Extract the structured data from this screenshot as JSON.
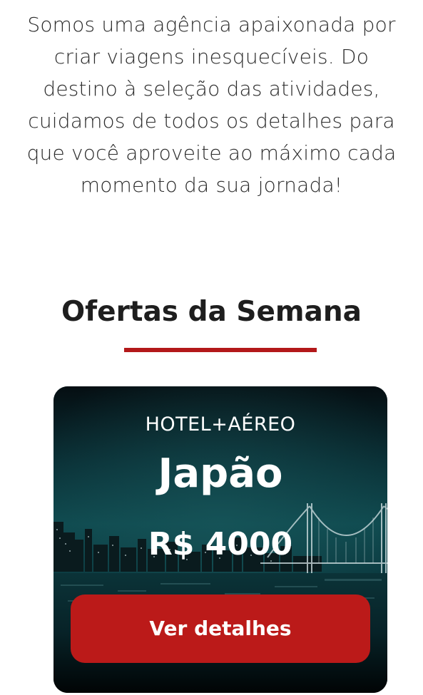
{
  "intro": {
    "text": "Somos uma agência apaixonada por criar viagens inesquecíveis. Do destino à seleção das atividades, cuidamos de todos os detalhes para que você aproveite ao máximo cada momento da sua jornada!"
  },
  "offers": {
    "title": "Ofertas da Semana",
    "accent_color": "#b3181a",
    "items": [
      {
        "category": "HOTEL+AÉREO",
        "destination": "Japão",
        "price": "R$ 4000",
        "button_label": "Ver detalhes",
        "button_color": "#bb1a19",
        "background_image": "night-city-skyline-bridge"
      }
    ]
  }
}
